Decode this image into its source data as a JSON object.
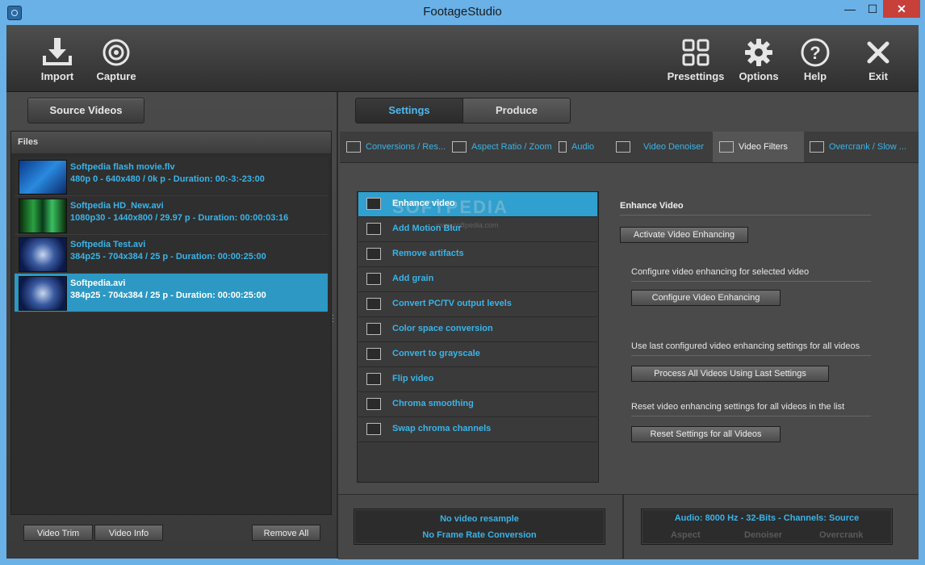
{
  "window": {
    "title": "FootageStudio"
  },
  "toolbar": {
    "left": [
      {
        "label": "Import",
        "icon": "import-icon"
      },
      {
        "label": "Capture",
        "icon": "capture-icon"
      }
    ],
    "right": [
      {
        "label": "Presettings",
        "icon": "presettings-icon"
      },
      {
        "label": "Options",
        "icon": "gear-icon"
      },
      {
        "label": "Help",
        "icon": "help-icon"
      },
      {
        "label": "Exit",
        "icon": "exit-icon"
      }
    ]
  },
  "left_panel": {
    "source_button": "Source Videos",
    "files_header": "Files",
    "files": [
      {
        "name": "Softpedia flash movie.flv",
        "meta": "480p 0 - 640x480 / 0k p - Duration:  00:-3:-23:00",
        "selected": false
      },
      {
        "name": "Softpedia HD_New.avi",
        "meta": "1080p30 - 1440x800 / 29.97 p  - Duration:  00:00:03:16",
        "selected": false
      },
      {
        "name": "Softpedia Test.avi",
        "meta": "384p25 - 704x384 / 25 p - Duration:  00:00:25:00",
        "selected": false
      },
      {
        "name": "Softpedia.avi",
        "meta": "384p25 - 704x384 / 25 p - Duration:  00:00:25:00",
        "selected": true
      }
    ],
    "buttons": {
      "video_trim": "Video Trim",
      "video_info": "Video Info",
      "remove_all": "Remove All"
    }
  },
  "tabs": {
    "settings": "Settings",
    "produce": "Produce",
    "active": "Settings"
  },
  "subtabs": [
    {
      "label": "Conversions / Res..."
    },
    {
      "label": "Aspect Ratio / Zoom"
    },
    {
      "label": "Audio"
    },
    {
      "label": "Video Denoiser"
    },
    {
      "label": "Video Filters",
      "active": true
    },
    {
      "label": "Overcrank / Slow ..."
    }
  ],
  "filters": [
    {
      "label": "Enhance video",
      "selected": true
    },
    {
      "label": "Add Motion Blur"
    },
    {
      "label": "Remove artifacts"
    },
    {
      "label": "Add grain"
    },
    {
      "label": "Convert PC/TV output levels"
    },
    {
      "label": "Color space conversion"
    },
    {
      "label": "Convert to grayscale"
    },
    {
      "label": "Flip video"
    },
    {
      "label": "Chroma smoothing"
    },
    {
      "label": "Swap chroma channels"
    }
  ],
  "watermark": {
    "main": "SOFTPEDIA",
    "sub": "www.softpedia.com"
  },
  "enhance": {
    "title": "Enhance Video",
    "activate_button": "Activate Video Enhancing",
    "configure_desc": "Configure video enhancing for selected video",
    "configure_button": "Configure Video Enhancing",
    "process_desc": "Use last configured video enhancing settings for all videos",
    "process_button": "Process All Videos Using Last Settings",
    "reset_desc": "Reset video enhancing settings for all videos in the list",
    "reset_button": "Reset Settings for all Videos"
  },
  "status": {
    "resample": "No video resample",
    "framerate": "No Frame Rate Conversion",
    "audio": "Audio: 8000 Hz - 32-Bits - Channels: Source",
    "aspect": "Aspect",
    "denoiser": "Denoiser",
    "overcrank": "Overcrank"
  },
  "colors": {
    "accent": "#3ab4e8",
    "selection": "#2d98c4",
    "titlebar": "#6ab1e8"
  }
}
